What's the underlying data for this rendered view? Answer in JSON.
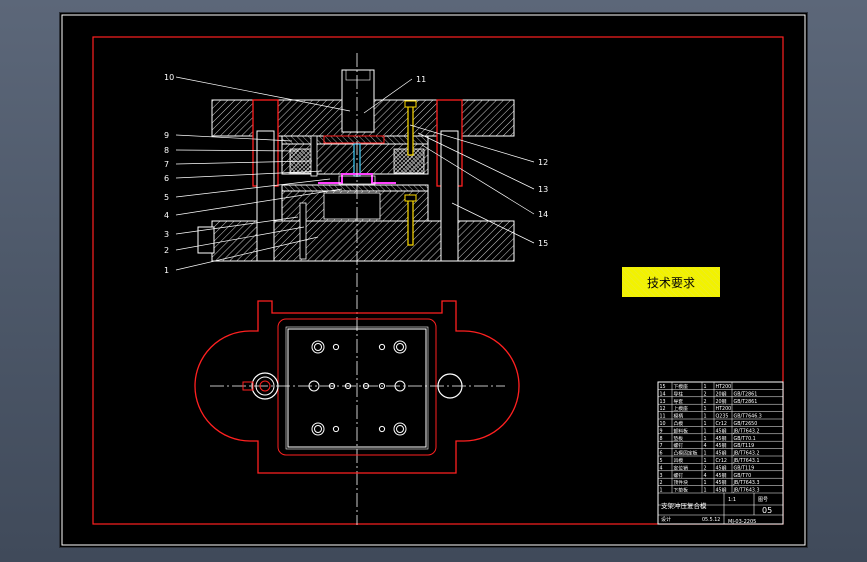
{
  "drawing": {
    "callouts_left": [
      "10",
      "9",
      "8",
      "7",
      "6",
      "5",
      "4",
      "3",
      "2",
      "1"
    ],
    "callouts_right": [
      "11",
      "12",
      "13",
      "14",
      "15"
    ],
    "technical_requirements_label": "技术要求",
    "colors": {
      "border": "#ff2020",
      "line": "#ffffff",
      "hatch": "#d8d8d8",
      "part_outline": "#ff2020",
      "highlight_blue": "#40d0ff",
      "highlight_magenta": "#ff40ff",
      "yellow_note": "#ffff00",
      "centerline": "#ffffff"
    }
  },
  "title_block": {
    "rows": [
      {
        "no": "15",
        "name": "下模座",
        "qty": "1",
        "material": "HT200",
        "std": ""
      },
      {
        "no": "14",
        "name": "导柱",
        "qty": "2",
        "material": "20钢",
        "std": "GB/T2861"
      },
      {
        "no": "13",
        "name": "导套",
        "qty": "2",
        "material": "20钢",
        "std": "GB/T2861"
      },
      {
        "no": "12",
        "name": "上模座",
        "qty": "1",
        "material": "HT200",
        "std": ""
      },
      {
        "no": "11",
        "name": "模柄",
        "qty": "1",
        "material": "Q235",
        "std": "GB/T7646.3"
      },
      {
        "no": "10",
        "name": "凸模",
        "qty": "1",
        "material": "Cr12",
        "std": "GB/T2650"
      },
      {
        "no": "9",
        "name": "卸料板",
        "qty": "1",
        "material": "45钢",
        "std": "JB/T7643.2"
      },
      {
        "no": "8",
        "name": "垫板",
        "qty": "1",
        "material": "45钢",
        "std": "GB/T70.1"
      },
      {
        "no": "7",
        "name": "螺钉",
        "qty": "4",
        "material": "45钢",
        "std": "GB/T119"
      },
      {
        "no": "6",
        "name": "凸模固定板",
        "qty": "1",
        "material": "45钢",
        "std": "JB/T7643.2"
      },
      {
        "no": "5",
        "name": "凹模",
        "qty": "1",
        "material": "Cr12",
        "std": "JB/T7643.1"
      },
      {
        "no": "4",
        "name": "定位销",
        "qty": "2",
        "material": "45钢",
        "std": "GB/T119"
      },
      {
        "no": "3",
        "name": "螺钉",
        "qty": "4",
        "material": "45钢",
        "std": "GB/T70"
      },
      {
        "no": "2",
        "name": "顶件块",
        "qty": "1",
        "material": "45钢",
        "std": "JB/T7643.3"
      },
      {
        "no": "1",
        "name": "下垫板",
        "qty": "1",
        "material": "45钢",
        "std": "JB/T7643.3"
      }
    ],
    "title": "支架冲压复合模",
    "scale": "1:1",
    "sheet_label": "图号",
    "sheet_no": "05",
    "designer_label": "设计",
    "checker_label": "审核",
    "date": "05.5.12",
    "drawing_code": "MJ-03-2205"
  }
}
